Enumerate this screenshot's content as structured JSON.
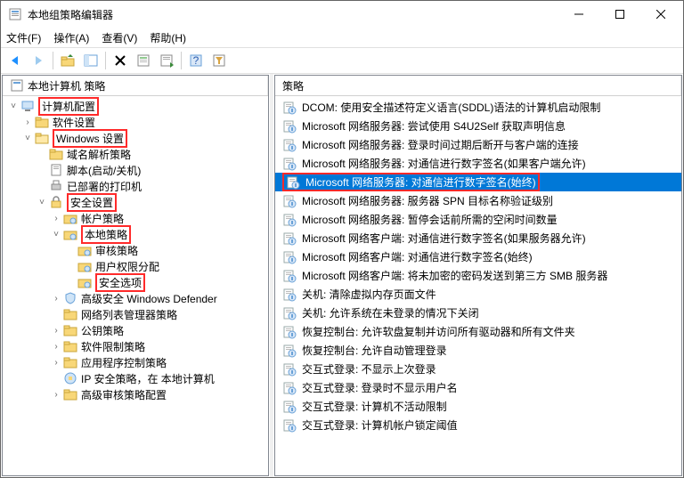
{
  "window": {
    "title": "本地组策略编辑器"
  },
  "menu": {
    "file": "文件(F)",
    "action": "操作(A)",
    "view": "查看(V)",
    "help": "帮助(H)"
  },
  "tree": {
    "header": "本地计算机 策略",
    "root": "计算机配置",
    "software": "软件设置",
    "windows": "Windows 设置",
    "dns": "域名解析策略",
    "scripts": "脚本(启动/关机)",
    "deployed": "已部署的打印机",
    "security": "安全设置",
    "account": "帐户策略",
    "local": "本地策略",
    "audit": "审核策略",
    "userrights": "用户权限分配",
    "secopts": "安全选项",
    "defender": "高级安全 Windows Defender",
    "netlist": "网络列表管理器策略",
    "pubkey": "公钥策略",
    "swrestrict": "软件限制策略",
    "appctrl": "应用程序控制策略",
    "ipsec": "IP 安全策略，在 本地计算机",
    "advaudit": "高级审核策略配置"
  },
  "list": {
    "header": "策略",
    "items": [
      "DCOM: 使用安全描述符定义语言(SDDL)语法的计算机启动限制",
      "Microsoft 网络服务器: 尝试使用 S4U2Self 获取声明信息",
      "Microsoft 网络服务器: 登录时间过期后断开与客户端的连接",
      "Microsoft 网络服务器: 对通信进行数字签名(如果客户端允许)",
      "Microsoft 网络服务器: 对通信进行数字签名(始终)",
      "Microsoft 网络服务器: 服务器 SPN 目标名称验证级别",
      "Microsoft 网络服务器: 暂停会话前所需的空闲时间数量",
      "Microsoft 网络客户端: 对通信进行数字签名(如果服务器允许)",
      "Microsoft 网络客户端: 对通信进行数字签名(始终)",
      "Microsoft 网络客户端: 将未加密的密码发送到第三方 SMB 服务器",
      "关机: 清除虚拟内存页面文件",
      "关机: 允许系统在未登录的情况下关闭",
      "恢复控制台: 允许软盘复制并访问所有驱动器和所有文件夹",
      "恢复控制台: 允许自动管理登录",
      "交互式登录: 不显示上次登录",
      "交互式登录: 登录时不显示用户名",
      "交互式登录: 计算机不活动限制",
      "交互式登录: 计算机帐户锁定阈值"
    ],
    "selected": 4
  }
}
